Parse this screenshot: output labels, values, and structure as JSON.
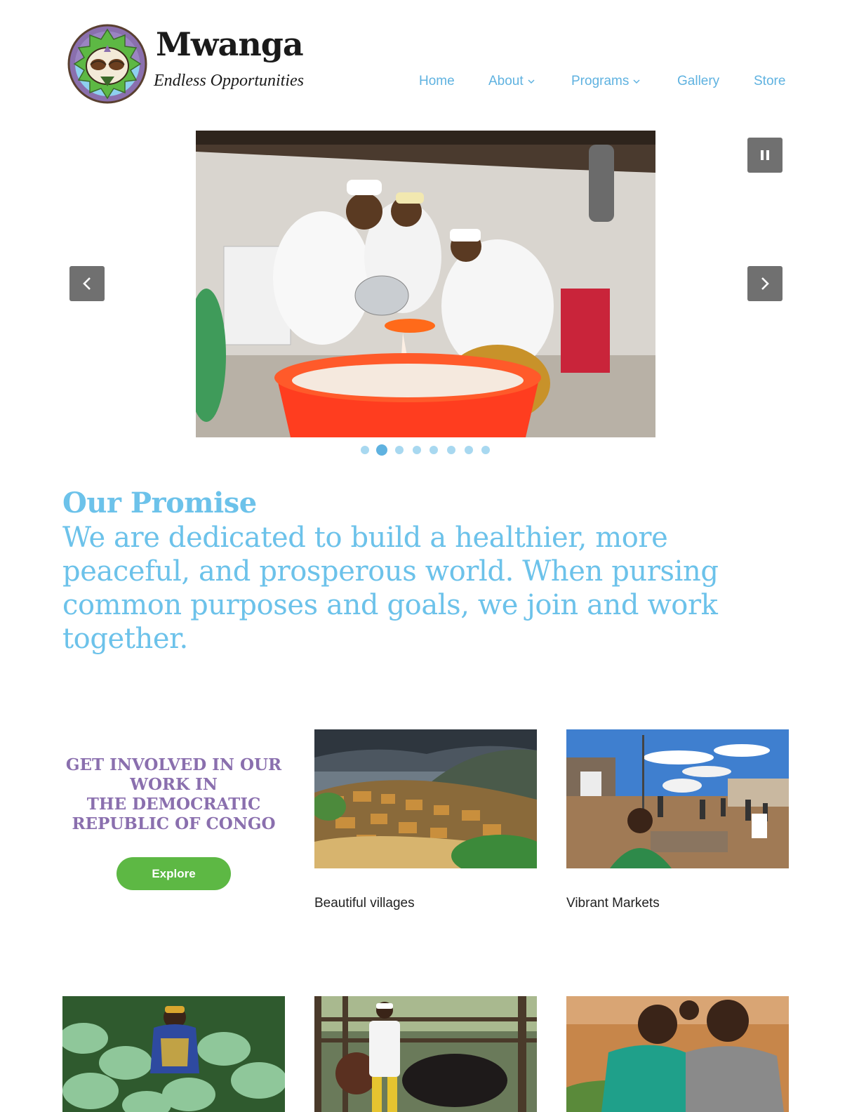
{
  "header": {
    "brand_name": "Mwanga",
    "tagline": "Endless Opportunities",
    "logo_icon": "mask-emblem-icon"
  },
  "nav": {
    "items": [
      {
        "label": "Home",
        "has_dropdown": false
      },
      {
        "label": "About",
        "has_dropdown": true
      },
      {
        "label": "Programs",
        "has_dropdown": true
      },
      {
        "label": "Gallery",
        "has_dropdown": false
      },
      {
        "label": "Store",
        "has_dropdown": false
      }
    ]
  },
  "slider": {
    "icons": {
      "pause": "pause-icon",
      "prev": "chevron-left-icon",
      "next": "chevron-right-icon"
    },
    "dot_count": 8,
    "active_index": 1
  },
  "promise": {
    "title": "Our Promise",
    "text": "We are dedicated to build a healthier, more peaceful, and prosperous world. When pursing common purposes and goals, we join and work together."
  },
  "cta": {
    "heading_lines": [
      "GET INVOLVED IN OUR",
      "WORK IN",
      "THE DEMOCRATIC",
      "REPUBLIC OF CONGO"
    ],
    "button_label": "Explore"
  },
  "gallery": {
    "captions": [
      "Beautiful villages",
      "Vibrant Markets"
    ]
  },
  "colors": {
    "accent_blue": "#6cc2ea",
    "purple": "#8a6fae",
    "green": "#5db844",
    "control_gray": "#707070"
  }
}
